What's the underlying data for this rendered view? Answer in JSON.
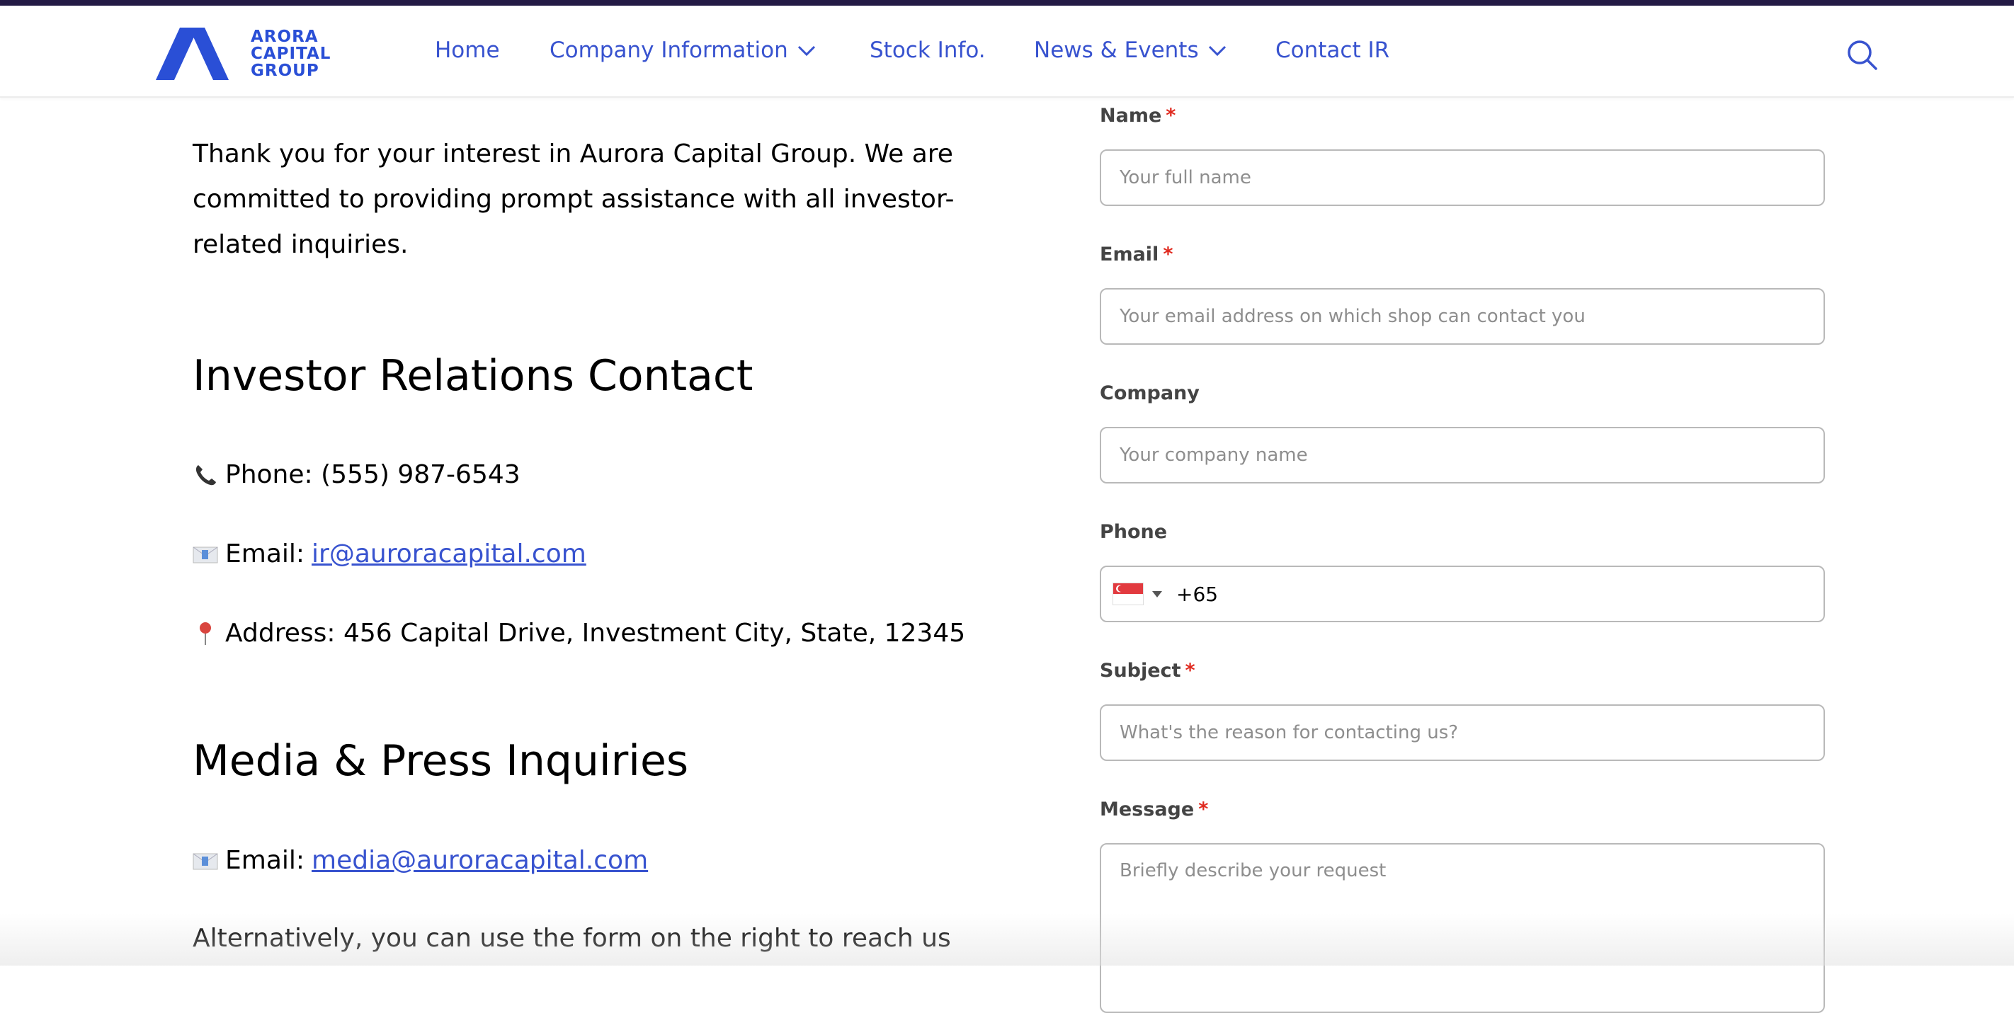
{
  "brand": {
    "logo_lines": [
      "ARORA",
      "CAPITAL",
      "GROUP"
    ],
    "primary_color": "#3853cf",
    "topbar_color": "#231a45"
  },
  "nav": {
    "items": [
      {
        "label": "Home",
        "has_dropdown": false
      },
      {
        "label": "Company Information",
        "has_dropdown": true
      },
      {
        "label": "Stock Info.",
        "has_dropdown": false
      },
      {
        "label": "News & Events",
        "has_dropdown": true
      },
      {
        "label": "Contact IR",
        "has_dropdown": false
      }
    ],
    "search_icon": "search-icon"
  },
  "content": {
    "intro": "Thank you for your interest in Aurora Capital Group. We are committed to providing prompt assistance with all investor-related inquiries.",
    "ir_section": {
      "heading": "Investor Relations Contact",
      "phone_icon": "telephone-receiver-icon",
      "phone_label": "Phone: (555) 987-6543",
      "email_icon": "envelope-icon",
      "email_label": "Email:",
      "email_link": "ir@auroracapital.com",
      "address_icon": "round-pushpin-icon",
      "address_label": "Address: 456 Capital Drive, Investment City, State, 12345"
    },
    "media_section": {
      "heading": "Media & Press Inquiries",
      "email_icon": "envelope-icon",
      "email_label": "Email:",
      "email_link": "media@auroracapital.com"
    },
    "alternative_text": "Alternatively, you can use the form on the right to reach us"
  },
  "form": {
    "required_marker": "*",
    "name": {
      "label": "Name",
      "required": true,
      "placeholder": "Your full name",
      "value": ""
    },
    "email": {
      "label": "Email",
      "required": true,
      "placeholder": "Your email address on which shop can contact you",
      "value": ""
    },
    "company": {
      "label": "Company",
      "required": false,
      "placeholder": "Your company name",
      "value": ""
    },
    "phone": {
      "label": "Phone",
      "required": false,
      "country": "Singapore",
      "country_flag_icon": "singapore-flag-icon",
      "value": "+65"
    },
    "subject": {
      "label": "Subject",
      "required": true,
      "placeholder": "What's the reason for contacting us?",
      "value": ""
    },
    "message": {
      "label": "Message",
      "required": true,
      "placeholder": "Briefly describe your request",
      "value": ""
    }
  }
}
